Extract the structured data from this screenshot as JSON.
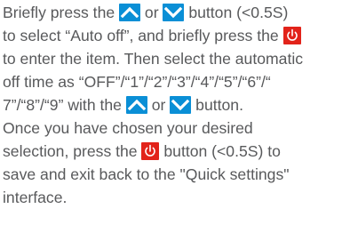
{
  "colors": {
    "text": "#58595b",
    "arrow_icon_bg": "#0a8fd6",
    "power_icon_bg": "#e2231a",
    "icon_glyph": "#ffffff"
  },
  "icons": {
    "up": "up-arrow-button-icon",
    "down": "down-arrow-button-icon",
    "power": "power-button-icon"
  },
  "text": {
    "l1_a": "Briefly press the ",
    "l1_b": " or ",
    "l1_c": " button (<0.5S)",
    "l2_a": "to select “Auto off”, and briefly press the ",
    "l3_a": "to enter the item. Then select the automatic",
    "l4_a": "off time as “OFF”/“1”/“2”/“3”/“4”/“5”/“6”/“",
    "l5_a": "7”/“8”/“9” with the ",
    "l5_b": " or ",
    "l5_c": " button.",
    "l6_a": "Once you have chosen your desired",
    "l7_a": "selection, press the ",
    "l7_b": " button (<0.5S) to",
    "l8_a": "save and exit back to the \"Quick settings\"",
    "l9_a": "interface."
  }
}
